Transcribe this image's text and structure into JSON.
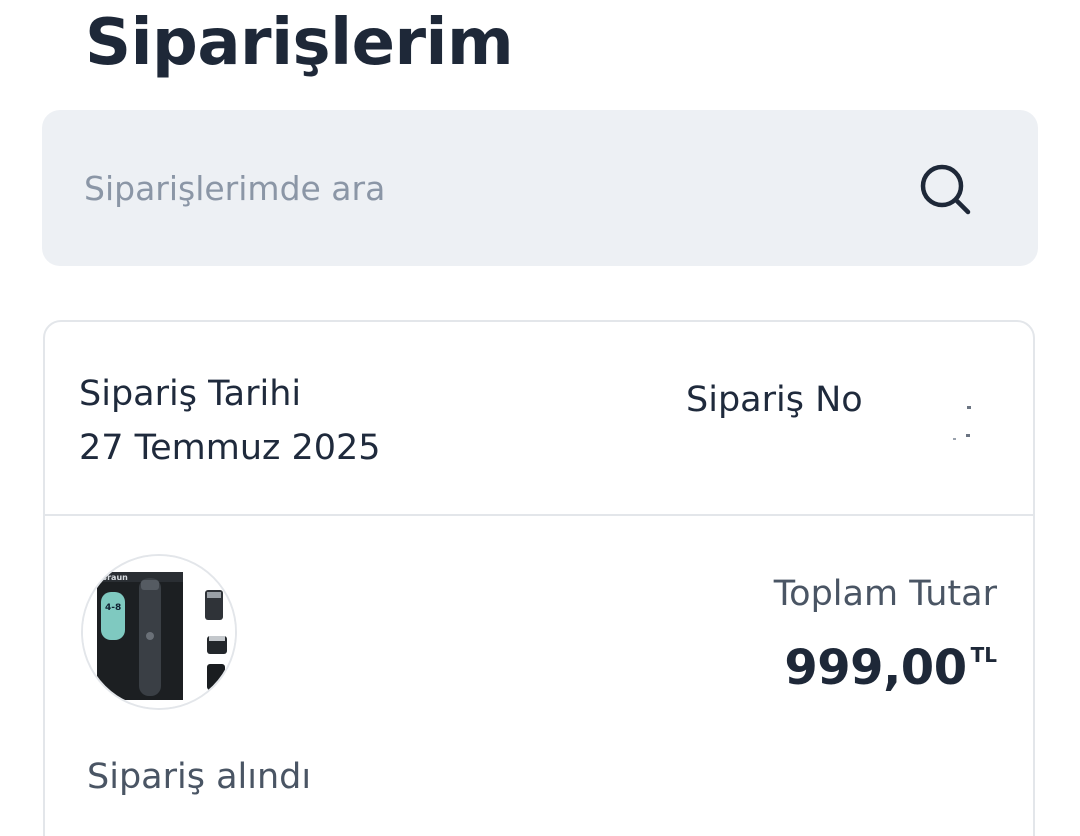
{
  "page": {
    "title": "Siparişlerim"
  },
  "search": {
    "placeholder": "Siparişlerimde ara",
    "value": "",
    "icon": "search-icon"
  },
  "order": {
    "date_label": "Sipariş Tarihi",
    "date_value": "27 Temmuz 2025",
    "order_no_label": "Sipariş No",
    "total_label": "Toplam Tutar",
    "total_value": "999,00",
    "currency": "TL",
    "status": "Sipariş alındı",
    "product_image": "hair-trimmer-kit-image"
  },
  "colors": {
    "title": "#1e2838",
    "search_bg": "#edf0f4",
    "placeholder": "#8b96a6",
    "border": "#e3e6ea",
    "muted_text": "#4a5564"
  }
}
